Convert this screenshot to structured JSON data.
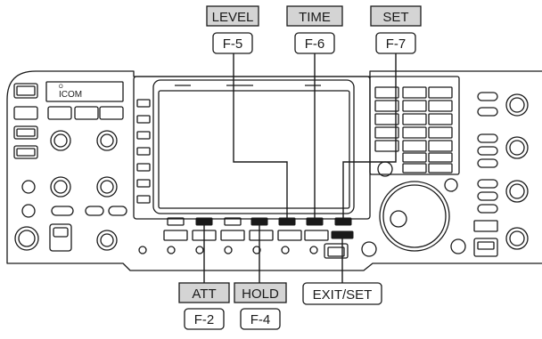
{
  "top_callouts": [
    {
      "name": "LEVEL",
      "key": "F-5"
    },
    {
      "name": "TIME",
      "key": "F-6"
    },
    {
      "name": "SET",
      "key": "F-7"
    }
  ],
  "bottom_callouts": [
    {
      "name": "ATT",
      "key": "F-2"
    },
    {
      "name": "HOLD",
      "key": "F-4"
    },
    {
      "name": "EXIT/SET",
      "key": ""
    }
  ],
  "panel": {
    "logo": "ICOM",
    "logo_mark": "O"
  },
  "colors": {
    "label_fill": "#d4d4d4",
    "panel_fill": "#ffffff",
    "stroke": "#1a1a1a",
    "highlight_key": "#1a1a1a"
  }
}
